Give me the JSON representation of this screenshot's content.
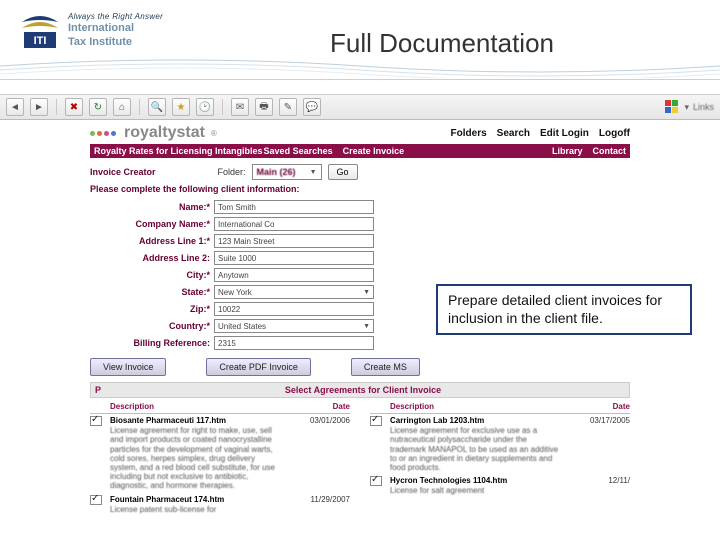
{
  "header": {
    "logo_tag": "Always the Right Answer",
    "logo_name1": "International",
    "logo_name2": "Tax Institute",
    "slide_title": "Full Documentation"
  },
  "callout": "Prepare detailed client invoices for inclusion in the client file.",
  "slide_number": "",
  "toolbar": {
    "menu_hint": "Links"
  },
  "rs": {
    "brand": "royaltystat",
    "nav": [
      "Folders",
      "Search",
      "Edit Login",
      "Logoff"
    ]
  },
  "darkbar": {
    "left": "Royalty Rates for Licensing Intangibles",
    "mid1": "Saved Searches",
    "mid2": "Create Invoice",
    "right1": "Library",
    "right2": "Contact"
  },
  "creator": {
    "title": "Invoice Creator",
    "folder_label": "Folder:",
    "folder_value": "Main (26)",
    "go": "Go"
  },
  "instruction": "Please complete the following client information:",
  "form": {
    "name_label": "Name:",
    "name_value": "Tom Smith",
    "company_label": "Company Name:",
    "company_value": "International Co",
    "addr1_label": "Address Line 1:",
    "addr1_value": "123 Main Street",
    "addr2_label": "Address Line 2:",
    "addr2_value": "Suite 1000",
    "city_label": "City:",
    "city_value": "Anytown",
    "state_label": "State:",
    "state_value": "New York",
    "zip_label": "Zip:",
    "zip_value": "10022",
    "country_label": "Country:",
    "country_value": "United States",
    "billing_label": "Billing Reference:",
    "billing_value": "2315"
  },
  "actions": {
    "view": "View Invoice",
    "pdf": "Create PDF Invoice",
    "ms": "Create MS"
  },
  "select_bar": {
    "p": "P",
    "title": "Select Agreements for Client Invoice"
  },
  "ag_head": {
    "desc": "Description",
    "date": "Date"
  },
  "agreements_left": [
    {
      "title": "Biosante Pharmaceuti 117.htm",
      "date": "03/01/2006",
      "body": "License agreement for right to make, use, sell and import products or coated nanocrystalline particles for the development of vaginal warts, cold sores, herpes simplex, drug delivery system, and a red blood cell substitute, for use including but not exclusive to antibiotic, diagnostic, and hormone therapies.",
      "checked": true
    },
    {
      "title": "Fountain Pharmaceut 174.htm",
      "date": "11/29/2007",
      "body": "License patent sub-license for",
      "checked": true
    }
  ],
  "agreements_right": [
    {
      "title": "Carrington Lab 1203.htm",
      "date": "03/17/2005",
      "body": "License agreement for exclusive use as a nutraceutical polysaccharide under the trademark MANAPOL to be used as an additive to or an ingredient in dietary supplements and food products.",
      "checked": true
    },
    {
      "title": "Hycron Technologies 1104.htm",
      "date": "12/11/",
      "body": "License for salt agreement",
      "checked": true
    }
  ]
}
